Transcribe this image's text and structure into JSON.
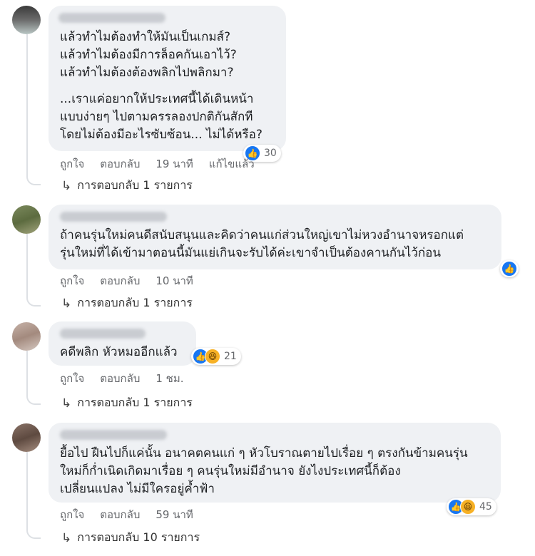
{
  "comments": [
    {
      "lines": [
        "แล้วทำไมต้องทำให้มันเป็นเกมส์?",
        "แล้วทำไมต้องมีการล็อคกันเอาไว้?",
        "แล้วทำไมต้องต้องพลิกไปพลิกมา?"
      ],
      "lines2": [
        "...เราแค่อยากให้ประเทศนี้ได้เดินหน้า",
        "แบบง่ายๆ ไปตามครรลองปกติกันสักที",
        "โดยไม่ต้องมีอะไรซับซ้อน... ไม่ได้หรือ?"
      ],
      "like": "ถูกใจ",
      "reply": "ตอบกลับ",
      "time": "19 นาที",
      "edited": "แก้ไขแล้ว",
      "reaction_count": "30",
      "replies": "การตอบกลับ 1 รายการ"
    },
    {
      "lines": [
        "ถ้าคนรุ่นใหม่คนดีสนับสนุนและคิดว่าคนแก่ส่วนใหญ่เขาไม่หวงอำนาจหรอกแต่",
        "รุ่นใหม่ที่ได้เข้ามาตอนนี้มันแย่เกินจะรับได้ค่ะเขาจำเป็นต้องคานกันไว้ก่อน"
      ],
      "like": "ถูกใจ",
      "reply": "ตอบกลับ",
      "time": "10 นาที",
      "reaction_count": "",
      "replies": "การตอบกลับ 1 รายการ"
    },
    {
      "lines": [
        "คดีพลิก หัวหมออีกแล้ว"
      ],
      "like": "ถูกใจ",
      "reply": "ตอบกลับ",
      "time": "1 ชม.",
      "reaction_count": "21",
      "replies": "การตอบกลับ 1 รายการ"
    },
    {
      "lines": [
        "ยื้อไป ฝืนไปก็แค่นั้น อนาคตคนแก่ ๆ หัวโบราณตายไปเรื่อย ๆ ตรงกันข้ามคนรุ่น",
        "ใหม่ก็ก่ำเนิดเกิดมาเรื่อย ๆ คนรุ่นใหม่มีอำนาจ ยังไงประเทศนี้ก็ต้อง",
        "เปลี่ยนแปลง ไม่มีใครอยู่ค้ำฟ้า"
      ],
      "like": "ถูกใจ",
      "reply": "ตอบกลับ",
      "time": "59 นาที",
      "reaction_count": "45",
      "replies": "การตอบกลับ 10 รายการ"
    }
  ],
  "icons": {
    "reply_arrow": "reply-arrow-icon",
    "like": "like-icon",
    "haha": "haha-icon"
  },
  "colors": {
    "bubble": "#eff1f4",
    "like_blue": "#1877f2",
    "haha_yellow": "#f7b125",
    "meta_gray": "#65676b"
  }
}
